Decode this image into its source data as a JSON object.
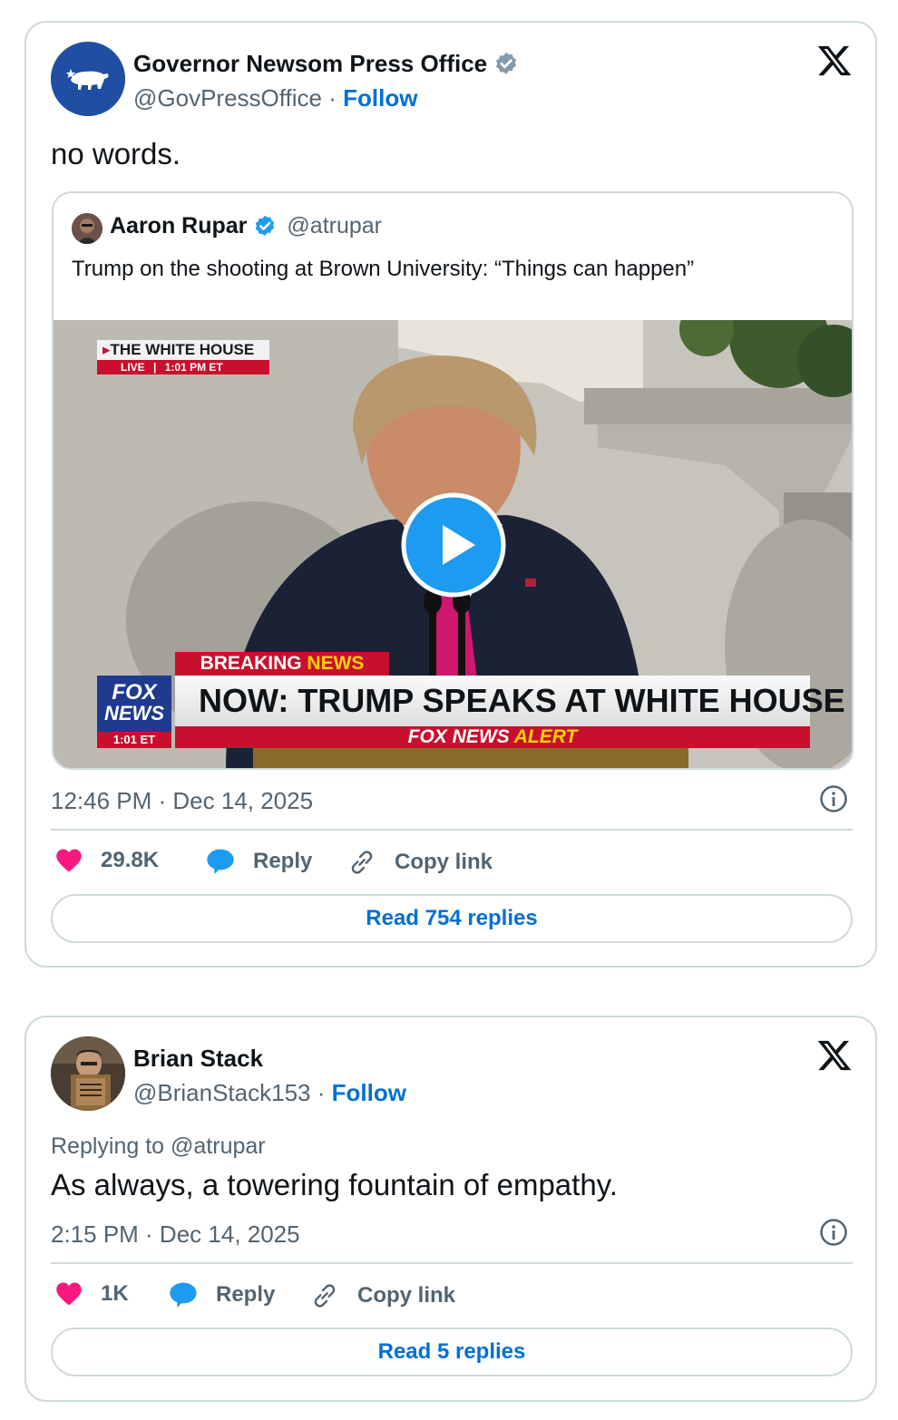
{
  "tweet1": {
    "author_name": "Governor Newsom Press Office",
    "handle": "@GovPressOffice",
    "separator": "·",
    "follow_label": "Follow",
    "text": "no words.",
    "quote": {
      "author_name": "Aaron Rupar",
      "handle": "@atrupar",
      "text": "Trump on the shooting at Brown University: “Things can happen”",
      "video": {
        "live_bug_title": "THE WHITE HOUSE",
        "live_label": "LIVE",
        "live_time": "1:01 PM ET",
        "breaking_label": "BREAKING",
        "news_label": "NEWS",
        "headline": "NOW: TRUMP SPEAKS AT WHITE HOUSE",
        "ticker_fox": "FOX NEWS",
        "ticker_alert": "ALERT",
        "network_logo_line1": "FOX",
        "network_logo_line2": "NEWS",
        "network_logo_time": "1:01 ET"
      }
    },
    "timestamp": "12:46 PM · Dec 14, 2025",
    "likes": "29.8K",
    "reply_label": "Reply",
    "copy_label": "Copy link",
    "read_replies": "Read 754 replies"
  },
  "tweet2": {
    "author_name": "Brian Stack",
    "handle": "@BrianStack153",
    "separator": "·",
    "follow_label": "Follow",
    "replying_to": "Replying to @atrupar",
    "text": "As always, a towering fountain of empathy.",
    "timestamp": "2:15 PM · Dec 14, 2025",
    "likes": "1K",
    "reply_label": "Reply",
    "copy_label": "Copy link",
    "read_replies": "Read 5 replies"
  },
  "colors": {
    "link_blue": "#006fd6",
    "like_pink": "#f91880",
    "reply_blue": "#1d9bf0",
    "verified_gray": "#829aab",
    "verified_blue": "#1d9bf0",
    "fox_red": "#c8102e",
    "fox_blue": "#1f3a8f"
  },
  "icons": [
    "x-logo-icon",
    "verified-badge-icon",
    "heart-icon",
    "reply-bubble-icon",
    "link-icon",
    "info-icon",
    "play-icon"
  ]
}
